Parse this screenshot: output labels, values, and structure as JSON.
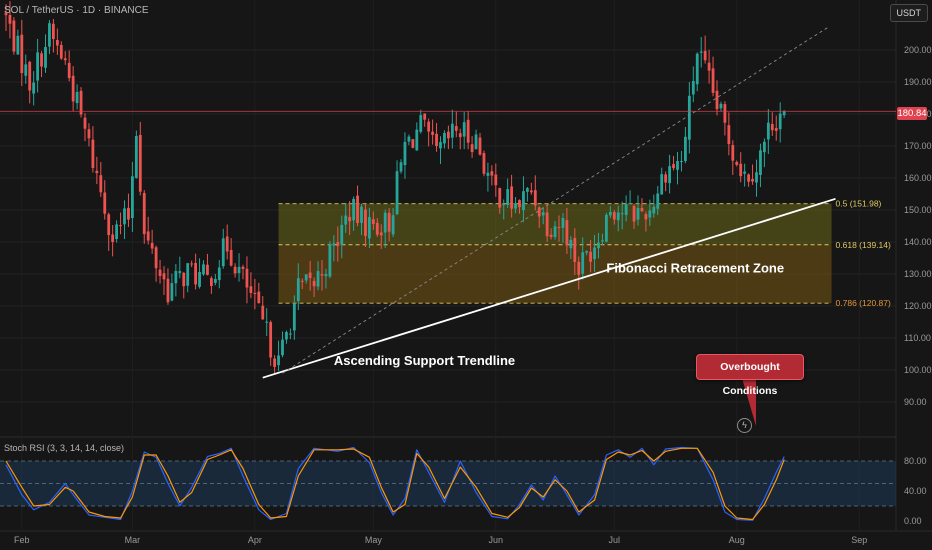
{
  "header": {
    "title": "SOL / TetherUS · 1D · BINANCE",
    "currency": "USDT"
  },
  "chart_data": [
    {
      "type": "candlestick",
      "title": "SOL / TetherUS · 1D · BINANCE",
      "x_tick_labels": [
        "Feb",
        "Mar",
        "Apr",
        "May",
        "Jun",
        "Jul",
        "Aug",
        "Sep"
      ],
      "y_tick_labels": [
        "200.00",
        "190.00",
        "180.00",
        "170.00",
        "160.00",
        "150.00",
        "140.00",
        "130.00",
        "120.00",
        "110.00",
        "100.00",
        "90.00"
      ],
      "ylim": [
        81,
        213
      ],
      "y_unit": "USDT",
      "last_price": 180.84,
      "last_price_label": "180.84",
      "close_path": [
        {
          "date": "2025-01-28",
          "close": 210
        },
        {
          "date": "2025-02-03",
          "close": 190
        },
        {
          "date": "2025-02-08",
          "close": 205
        },
        {
          "date": "2025-02-12",
          "close": 196
        },
        {
          "date": "2025-02-18",
          "close": 170
        },
        {
          "date": "2025-02-24",
          "close": 142
        },
        {
          "date": "2025-02-28",
          "close": 148
        },
        {
          "date": "2025-03-02",
          "close": 176
        },
        {
          "date": "2025-03-04",
          "close": 142
        },
        {
          "date": "2025-03-10",
          "close": 125
        },
        {
          "date": "2025-03-15",
          "close": 131
        },
        {
          "date": "2025-03-20",
          "close": 128
        },
        {
          "date": "2025-03-25",
          "close": 139
        },
        {
          "date": "2025-03-31",
          "close": 123
        },
        {
          "date": "2025-04-07",
          "close": 102
        },
        {
          "date": "2025-04-12",
          "close": 125
        },
        {
          "date": "2025-04-16",
          "close": 127
        },
        {
          "date": "2025-04-21",
          "close": 138
        },
        {
          "date": "2025-04-25",
          "close": 150
        },
        {
          "date": "2025-04-30",
          "close": 145
        },
        {
          "date": "2025-05-05",
          "close": 146
        },
        {
          "date": "2025-05-09",
          "close": 170
        },
        {
          "date": "2025-05-13",
          "close": 176
        },
        {
          "date": "2025-05-17",
          "close": 167
        },
        {
          "date": "2025-05-22",
          "close": 175
        },
        {
          "date": "2025-05-27",
          "close": 172
        },
        {
          "date": "2025-05-31",
          "close": 157
        },
        {
          "date": "2025-06-06",
          "close": 151
        },
        {
          "date": "2025-06-10",
          "close": 156
        },
        {
          "date": "2025-06-14",
          "close": 146
        },
        {
          "date": "2025-06-18",
          "close": 146
        },
        {
          "date": "2025-06-22",
          "close": 132
        },
        {
          "date": "2025-06-27",
          "close": 142
        },
        {
          "date": "2025-06-30",
          "close": 151
        },
        {
          "date": "2025-07-05",
          "close": 149
        },
        {
          "date": "2025-07-10",
          "close": 150
        },
        {
          "date": "2025-07-14",
          "close": 163
        },
        {
          "date": "2025-07-18",
          "close": 165
        },
        {
          "date": "2025-07-22",
          "close": 200
        },
        {
          "date": "2025-07-26",
          "close": 186
        },
        {
          "date": "2025-07-31",
          "close": 169
        },
        {
          "date": "2025-08-03",
          "close": 161
        },
        {
          "date": "2025-08-06",
          "close": 164
        },
        {
          "date": "2025-08-10",
          "close": 178
        },
        {
          "date": "2025-08-13",
          "close": 181
        }
      ],
      "fibonacci_levels": [
        {
          "label": "0.5 (151.98)",
          "price": 151.98
        },
        {
          "label": "0.618 (139.14)",
          "price": 139.14
        },
        {
          "label": "0.786 (120.87)",
          "price": 120.87
        }
      ],
      "annotations": {
        "fib_zone": "Fibonacci Retracement Zone",
        "trendline": "Ascending Support Trendline",
        "overbought": "Overbought Conditions"
      },
      "trendlines": [
        {
          "style": "solid",
          "color": "#ffffff",
          "start": {
            "date": "2025-04-03",
            "price": 97.6
          },
          "end": {
            "date": "2025-08-26",
            "price": 153.5
          }
        },
        {
          "style": "dashed",
          "color": "#8a8a8a",
          "start": {
            "date": "2025-04-08",
            "price": 99
          },
          "end": {
            "date": "2025-08-24",
            "price": 207
          }
        }
      ]
    },
    {
      "type": "line",
      "title": "Stoch RSI (3, 3, 14, 14, close)",
      "ylim": [
        -2,
        107
      ],
      "y_tick_labels": [
        "80.00",
        "40.00",
        "0.00"
      ],
      "bands": {
        "upper": 80,
        "middle": 50,
        "lower": 20
      },
      "series": [
        {
          "color": "#2962ff",
          "points": [
            {
              "date": "2025-01-28",
              "value": 75
            },
            {
              "date": "2025-02-01",
              "value": 35
            },
            {
              "date": "2025-02-04",
              "value": 15
            },
            {
              "date": "2025-02-08",
              "value": 25
            },
            {
              "date": "2025-02-12",
              "value": 50
            },
            {
              "date": "2025-02-14",
              "value": 35
            },
            {
              "date": "2025-02-18",
              "value": 8
            },
            {
              "date": "2025-02-22",
              "value": 5
            },
            {
              "date": "2025-02-26",
              "value": 2
            },
            {
              "date": "2025-03-01",
              "value": 40
            },
            {
              "date": "2025-03-04",
              "value": 92
            },
            {
              "date": "2025-03-07",
              "value": 85
            },
            {
              "date": "2025-03-10",
              "value": 50
            },
            {
              "date": "2025-03-13",
              "value": 20
            },
            {
              "date": "2025-03-16",
              "value": 45
            },
            {
              "date": "2025-03-20",
              "value": 86
            },
            {
              "date": "2025-03-23",
              "value": 90
            },
            {
              "date": "2025-03-26",
              "value": 97
            },
            {
              "date": "2025-03-29",
              "value": 60
            },
            {
              "date": "2025-04-02",
              "value": 15
            },
            {
              "date": "2025-04-05",
              "value": 2
            },
            {
              "date": "2025-04-09",
              "value": 10
            },
            {
              "date": "2025-04-12",
              "value": 70
            },
            {
              "date": "2025-04-16",
              "value": 97
            },
            {
              "date": "2025-04-22",
              "value": 93
            },
            {
              "date": "2025-04-26",
              "value": 98
            },
            {
              "date": "2025-04-30",
              "value": 78
            },
            {
              "date": "2025-05-03",
              "value": 38
            },
            {
              "date": "2025-05-06",
              "value": 8
            },
            {
              "date": "2025-05-09",
              "value": 30
            },
            {
              "date": "2025-05-12",
              "value": 95
            },
            {
              "date": "2025-05-15",
              "value": 65
            },
            {
              "date": "2025-05-19",
              "value": 25
            },
            {
              "date": "2025-05-23",
              "value": 80
            },
            {
              "date": "2025-05-27",
              "value": 38
            },
            {
              "date": "2025-05-31",
              "value": 6
            },
            {
              "date": "2025-06-04",
              "value": 3
            },
            {
              "date": "2025-06-07",
              "value": 22
            },
            {
              "date": "2025-06-10",
              "value": 48
            },
            {
              "date": "2025-06-13",
              "value": 28
            },
            {
              "date": "2025-06-16",
              "value": 60
            },
            {
              "date": "2025-06-19",
              "value": 35
            },
            {
              "date": "2025-06-22",
              "value": 8
            },
            {
              "date": "2025-06-26",
              "value": 35
            },
            {
              "date": "2025-06-29",
              "value": 88
            },
            {
              "date": "2025-07-02",
              "value": 95
            },
            {
              "date": "2025-07-05",
              "value": 85
            },
            {
              "date": "2025-07-08",
              "value": 97
            },
            {
              "date": "2025-07-11",
              "value": 75
            },
            {
              "date": "2025-07-14",
              "value": 96
            },
            {
              "date": "2025-07-18",
              "value": 98
            },
            {
              "date": "2025-07-22",
              "value": 97
            },
            {
              "date": "2025-07-26",
              "value": 55
            },
            {
              "date": "2025-07-29",
              "value": 12
            },
            {
              "date": "2025-08-01",
              "value": 2
            },
            {
              "date": "2025-08-05",
              "value": 1
            },
            {
              "date": "2025-08-08",
              "value": 30
            },
            {
              "date": "2025-08-11",
              "value": 65
            },
            {
              "date": "2025-08-13",
              "value": 86
            }
          ]
        },
        {
          "color": "#ff9800",
          "points": [
            {
              "date": "2025-01-28",
              "value": 80
            },
            {
              "date": "2025-02-01",
              "value": 45
            },
            {
              "date": "2025-02-04",
              "value": 20
            },
            {
              "date": "2025-02-08",
              "value": 22
            },
            {
              "date": "2025-02-12",
              "value": 45
            },
            {
              "date": "2025-02-14",
              "value": 40
            },
            {
              "date": "2025-02-18",
              "value": 12
            },
            {
              "date": "2025-02-22",
              "value": 6
            },
            {
              "date": "2025-02-26",
              "value": 4
            },
            {
              "date": "2025-03-01",
              "value": 32
            },
            {
              "date": "2025-03-04",
              "value": 88
            },
            {
              "date": "2025-03-07",
              "value": 88
            },
            {
              "date": "2025-03-10",
              "value": 60
            },
            {
              "date": "2025-03-13",
              "value": 25
            },
            {
              "date": "2025-03-16",
              "value": 38
            },
            {
              "date": "2025-03-20",
              "value": 82
            },
            {
              "date": "2025-03-23",
              "value": 88
            },
            {
              "date": "2025-03-26",
              "value": 95
            },
            {
              "date": "2025-03-29",
              "value": 70
            },
            {
              "date": "2025-04-02",
              "value": 22
            },
            {
              "date": "2025-04-05",
              "value": 4
            },
            {
              "date": "2025-04-09",
              "value": 6
            },
            {
              "date": "2025-04-12",
              "value": 60
            },
            {
              "date": "2025-04-16",
              "value": 95
            },
            {
              "date": "2025-04-22",
              "value": 95
            },
            {
              "date": "2025-04-26",
              "value": 96
            },
            {
              "date": "2025-04-30",
              "value": 85
            },
            {
              "date": "2025-05-03",
              "value": 45
            },
            {
              "date": "2025-05-06",
              "value": 12
            },
            {
              "date": "2025-05-09",
              "value": 22
            },
            {
              "date": "2025-05-12",
              "value": 90
            },
            {
              "date": "2025-05-15",
              "value": 72
            },
            {
              "date": "2025-05-19",
              "value": 30
            },
            {
              "date": "2025-05-23",
              "value": 72
            },
            {
              "date": "2025-05-27",
              "value": 45
            },
            {
              "date": "2025-05-31",
              "value": 10
            },
            {
              "date": "2025-06-04",
              "value": 5
            },
            {
              "date": "2025-06-07",
              "value": 18
            },
            {
              "date": "2025-06-10",
              "value": 44
            },
            {
              "date": "2025-06-13",
              "value": 32
            },
            {
              "date": "2025-06-16",
              "value": 55
            },
            {
              "date": "2025-06-19",
              "value": 40
            },
            {
              "date": "2025-06-22",
              "value": 12
            },
            {
              "date": "2025-06-26",
              "value": 28
            },
            {
              "date": "2025-06-29",
              "value": 82
            },
            {
              "date": "2025-07-02",
              "value": 92
            },
            {
              "date": "2025-07-05",
              "value": 88
            },
            {
              "date": "2025-07-08",
              "value": 94
            },
            {
              "date": "2025-07-11",
              "value": 80
            },
            {
              "date": "2025-07-14",
              "value": 93
            },
            {
              "date": "2025-07-18",
              "value": 97
            },
            {
              "date": "2025-07-22",
              "value": 97
            },
            {
              "date": "2025-07-26",
              "value": 65
            },
            {
              "date": "2025-07-29",
              "value": 20
            },
            {
              "date": "2025-08-01",
              "value": 4
            },
            {
              "date": "2025-08-05",
              "value": 2
            },
            {
              "date": "2025-08-08",
              "value": 22
            },
            {
              "date": "2025-08-11",
              "value": 55
            },
            {
              "date": "2025-08-13",
              "value": 82
            }
          ]
        }
      ]
    }
  ],
  "oscillator": {
    "title": "Stoch RSI (3, 3, 14, 14, close)"
  },
  "colors": {
    "background": "#161616",
    "up": "#26a69a",
    "down": "#ef5350",
    "fib_zone": "#8a7a1c",
    "fib_line": "#e0c860",
    "trendline": "#ffffff",
    "dashed_trendline": "#8a8a8a",
    "stoch_k": "#2962ff",
    "stoch_d": "#ff9800",
    "price_tag": "#e0434f",
    "callout": "#b22a33"
  },
  "icons": {
    "lightning": "lightning-icon"
  }
}
